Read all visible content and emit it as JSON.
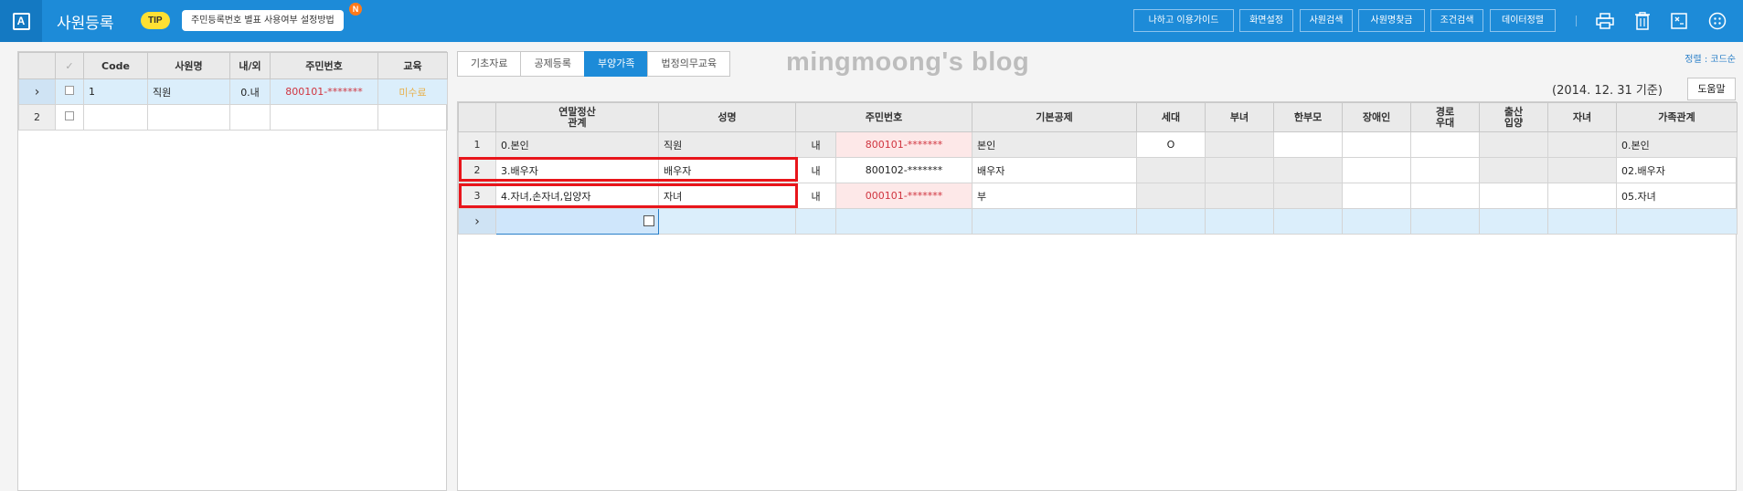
{
  "app": {
    "logo": "A",
    "title": "사원등록",
    "tip_badge": "TIP",
    "tip_text": "주민등록번호 별표 사용여부 설정방법",
    "tip_new": "N"
  },
  "toolbar": {
    "buttons": [
      "나하고 이용가이드",
      "화면설정",
      "사원검색",
      "사원명찾금",
      "조건검색",
      "데이터정렬"
    ],
    "icons": [
      "print-icon",
      "trash-icon",
      "excel-icon",
      "more-icon"
    ]
  },
  "employee_grid": {
    "headers": [
      "",
      "Code",
      "사원명",
      "내/외",
      "주민번호",
      "교육"
    ],
    "rows": [
      {
        "num": "›",
        "code": "1",
        "name": "직원",
        "nae": "0.내",
        "jumin": "800101-*******",
        "edu": "미수료"
      },
      {
        "num": "2",
        "code": "",
        "name": "",
        "nae": "",
        "jumin": "",
        "edu": ""
      }
    ]
  },
  "tabs": [
    "기초자료",
    "공제등록",
    "부양가족",
    "법정의무교육"
  ],
  "watermark": "mingmoong's blog",
  "sort_label": "정렬 : 코드순",
  "base_date": "(2014. 12. 31 기준)",
  "help_button": "도움말",
  "family_grid": {
    "headers": [
      "",
      "연말정산\n관계",
      "성명",
      "주민번호",
      "기본공제",
      "세대",
      "부녀",
      "한부모",
      "장애인",
      "경로\n우대",
      "출산\n입양",
      "자녀",
      "가족관계"
    ],
    "rows": [
      {
        "num": "1",
        "rel": "0.본인",
        "name": "직원",
        "nae": "내",
        "jumin": "800101-*******",
        "basic": "본인",
        "sedae": "O",
        "family": "0.본인"
      },
      {
        "num": "2",
        "rel": "3.배우자",
        "name": "배우자",
        "nae": "내",
        "jumin": "800102-*******",
        "basic": "배우자",
        "sedae": "",
        "family": "02.배우자"
      },
      {
        "num": "3",
        "rel": "4.자녀,손자녀,입양자",
        "name": "자녀",
        "nae": "내",
        "jumin": "000101-*******",
        "basic": "부",
        "sedae": "",
        "family": "05.자녀"
      }
    ],
    "new_row_marker": "›"
  }
}
